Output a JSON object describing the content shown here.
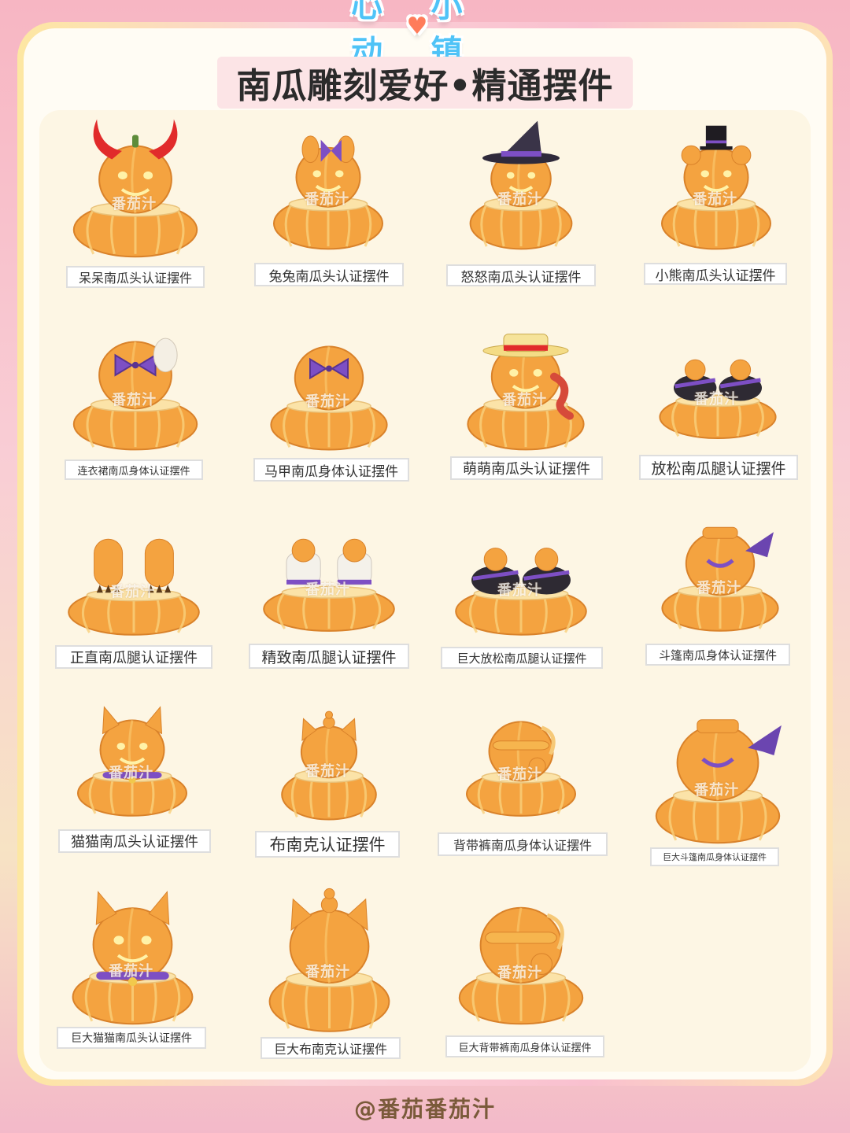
{
  "logo": {
    "text_left": "心动",
    "text_right": "小镇"
  },
  "title": "南瓜雕刻爱好•精通摆件",
  "watermark": "番茄汁",
  "footer": "@番茄番茄汁",
  "colors": {
    "pumpkin": "#f4a340",
    "pumpkin_dark": "#d9822a",
    "cream": "#fbe3a8",
    "purple": "#7d4fc4",
    "red": "#e12b2b"
  },
  "items": [
    {
      "label": "呆呆南瓜头认证摆件",
      "accessory": "devil-horns"
    },
    {
      "label": "兔兔南瓜头认证摆件",
      "accessory": "bunny-bow"
    },
    {
      "label": "怒怒南瓜头认证摆件",
      "accessory": "witch-hat"
    },
    {
      "label": "小熊南瓜头认证摆件",
      "accessory": "top-hat-bear"
    },
    {
      "label": "连衣裙南瓜身体认证摆件",
      "accessory": "dress-bow"
    },
    {
      "label": "马甲南瓜身体认证摆件",
      "accessory": "vest-bow"
    },
    {
      "label": "萌萌南瓜头认证摆件",
      "accessory": "straw-hat"
    },
    {
      "label": "放松南瓜腿认证摆件",
      "accessory": "black-shoes"
    },
    {
      "label": "正直南瓜腿认证摆件",
      "accessory": "claw-feet"
    },
    {
      "label": "精致南瓜腿认证摆件",
      "accessory": "white-boots"
    },
    {
      "label": "巨大放松南瓜腿认证摆件",
      "accessory": "big-black-shoes"
    },
    {
      "label": "斗篷南瓜身体认证摆件",
      "accessory": "bat-cape"
    },
    {
      "label": "猫猫南瓜头认证摆件",
      "accessory": "cat-collar"
    },
    {
      "label": "布南克认证摆件",
      "accessory": "bunny-tiered"
    },
    {
      "label": "背带裤南瓜身体认证摆件",
      "accessory": "overalls"
    },
    {
      "label": "巨大斗篷南瓜身体认证摆件",
      "accessory": "big-bat-cape"
    },
    {
      "label": "巨大猫猫南瓜头认证摆件",
      "accessory": "big-cat-collar"
    },
    {
      "label": "巨大布南克认证摆件",
      "accessory": "big-bunny-tiered"
    },
    {
      "label": "巨大背带裤南瓜身体认证摆件",
      "accessory": "big-overalls"
    }
  ]
}
